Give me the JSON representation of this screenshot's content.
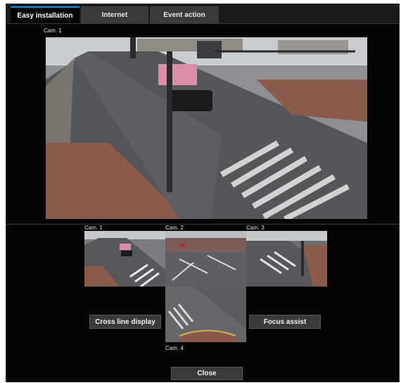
{
  "tabs": [
    {
      "label": "Easy installation",
      "active": true
    },
    {
      "label": "Internet",
      "active": false
    },
    {
      "label": "Event action",
      "active": false
    }
  ],
  "main_view": {
    "label": "Cam. 1"
  },
  "thumbnails": [
    {
      "label": "Cam. 1"
    },
    {
      "label": "Cam. 2"
    },
    {
      "label": "Cam. 3"
    },
    {
      "label": "Cam. 4"
    }
  ],
  "buttons": {
    "cross_line": "Cross line display",
    "focus_assist": "Focus assist",
    "close": "Close"
  },
  "colors": {
    "accent": "#1f88e5",
    "background": "#050505",
    "button": "#3a3a3a"
  }
}
